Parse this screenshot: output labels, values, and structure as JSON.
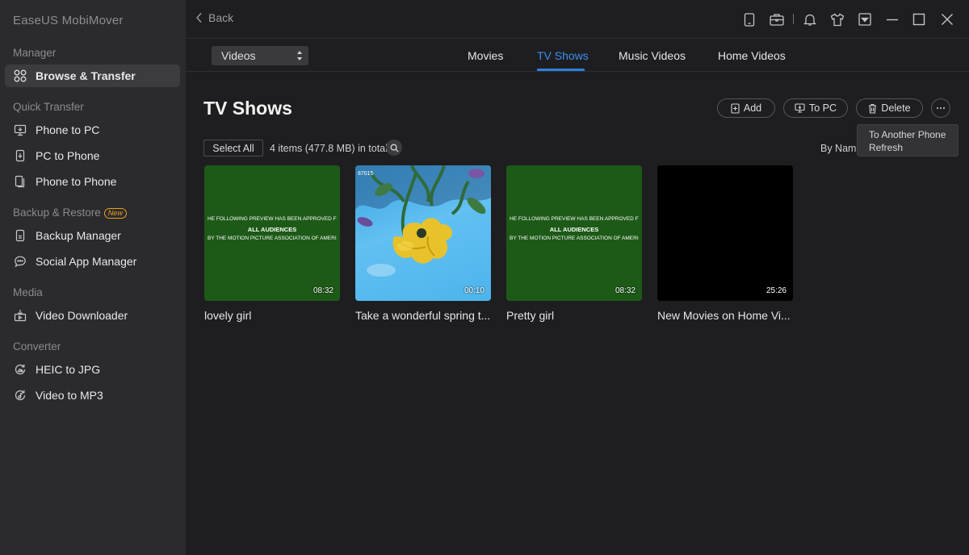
{
  "app_title": "EaseUS MobiMover",
  "sidebar": {
    "sections": [
      {
        "label": "Manager"
      },
      {
        "label": "Quick Transfer"
      },
      {
        "label": "Backup & Restore",
        "badge": "New"
      },
      {
        "label": "Media"
      },
      {
        "label": "Converter"
      }
    ],
    "items": [
      {
        "label": "Browse & Transfer",
        "icon": "grid-icon",
        "active": true
      },
      {
        "label": "Phone to PC",
        "icon": "monitor-icon"
      },
      {
        "label": "PC to Phone",
        "icon": "phone-icon"
      },
      {
        "label": "Phone to Phone",
        "icon": "phones-icon"
      },
      {
        "label": "Backup Manager",
        "icon": "backup-icon"
      },
      {
        "label": "Social App Manager",
        "icon": "chat-icon"
      },
      {
        "label": "Video Downloader",
        "icon": "download-icon"
      },
      {
        "label": "HEIC to JPG",
        "icon": "convert-icon"
      },
      {
        "label": "Video to MP3",
        "icon": "audio-convert-icon"
      }
    ]
  },
  "topbar": {
    "back_label": "Back",
    "icons": [
      "device-icon",
      "toolbox-icon",
      "bell-icon",
      "tshirt-icon",
      "dropdown-menu-icon",
      "minimize-icon",
      "maximize-icon",
      "close-icon"
    ]
  },
  "filter": {
    "category": "Videos",
    "tabs": [
      "Movies",
      "TV Shows",
      "Music Videos",
      "Home Videos"
    ],
    "active_tab": "TV Shows"
  },
  "content": {
    "title": "TV Shows",
    "buttons": {
      "add": "Add",
      "to_pc": "To PC",
      "delete": "Delete"
    },
    "more_menu": [
      "To Another Phone",
      "Refresh"
    ],
    "select_all": "Select All",
    "count": "4 items (477.8 MB) in total",
    "sort": "By Nam",
    "videos": [
      {
        "title": "lovely girl",
        "duration": "08:32",
        "thumb": "green-rating"
      },
      {
        "title": "Take a wonderful spring t...",
        "duration": "00:10",
        "thumb": "flower-sky"
      },
      {
        "title": "Pretty girl",
        "duration": "08:32",
        "thumb": "green-rating"
      },
      {
        "title": "New Movies on Home Vi...",
        "duration": "25:26",
        "thumb": "black"
      }
    ],
    "rating_card": {
      "line1": "HE FOLLOWING PREVIEW HAS BEEN APPROVED FOR",
      "line2": "ALL AUDIENCES",
      "line3": "BY THE MOTION PICTURE ASSOCIATION OF AMERICA, INC."
    },
    "flower_watermark": "87015"
  },
  "colors": {
    "accent": "#2f7fe0",
    "sidebar_bg": "#2b2b2e",
    "main_bg": "#1e1e21",
    "badge": "#e8a020"
  }
}
